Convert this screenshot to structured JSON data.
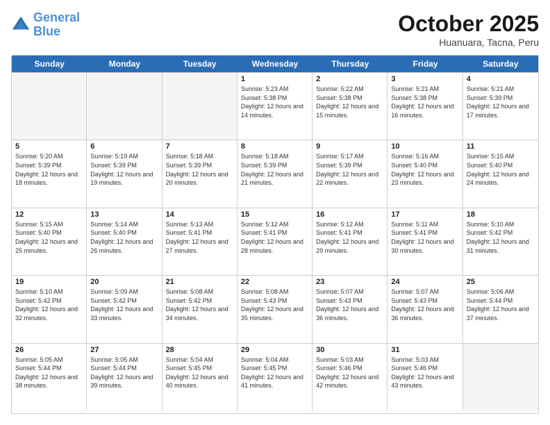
{
  "header": {
    "logo_line1": "General",
    "logo_line2": "Blue",
    "month": "October 2025",
    "location": "Huanuara, Tacna, Peru"
  },
  "weekdays": [
    "Sunday",
    "Monday",
    "Tuesday",
    "Wednesday",
    "Thursday",
    "Friday",
    "Saturday"
  ],
  "weeks": [
    [
      {
        "day": "",
        "info": "",
        "empty": true
      },
      {
        "day": "",
        "info": "",
        "empty": true
      },
      {
        "day": "",
        "info": "",
        "empty": true
      },
      {
        "day": "1",
        "info": "Sunrise: 5:23 AM\nSunset: 5:38 PM\nDaylight: 12 hours and 14 minutes.",
        "empty": false
      },
      {
        "day": "2",
        "info": "Sunrise: 5:22 AM\nSunset: 5:38 PM\nDaylight: 12 hours and 15 minutes.",
        "empty": false
      },
      {
        "day": "3",
        "info": "Sunrise: 5:21 AM\nSunset: 5:38 PM\nDaylight: 12 hours and 16 minutes.",
        "empty": false
      },
      {
        "day": "4",
        "info": "Sunrise: 5:21 AM\nSunset: 5:39 PM\nDaylight: 12 hours and 17 minutes.",
        "empty": false
      }
    ],
    [
      {
        "day": "5",
        "info": "Sunrise: 5:20 AM\nSunset: 5:39 PM\nDaylight: 12 hours and 18 minutes.",
        "empty": false
      },
      {
        "day": "6",
        "info": "Sunrise: 5:19 AM\nSunset: 5:39 PM\nDaylight: 12 hours and 19 minutes.",
        "empty": false
      },
      {
        "day": "7",
        "info": "Sunrise: 5:18 AM\nSunset: 5:39 PM\nDaylight: 12 hours and 20 minutes.",
        "empty": false
      },
      {
        "day": "8",
        "info": "Sunrise: 5:18 AM\nSunset: 5:39 PM\nDaylight: 12 hours and 21 minutes.",
        "empty": false
      },
      {
        "day": "9",
        "info": "Sunrise: 5:17 AM\nSunset: 5:39 PM\nDaylight: 12 hours and 22 minutes.",
        "empty": false
      },
      {
        "day": "10",
        "info": "Sunrise: 5:16 AM\nSunset: 5:40 PM\nDaylight: 12 hours and 23 minutes.",
        "empty": false
      },
      {
        "day": "11",
        "info": "Sunrise: 5:15 AM\nSunset: 5:40 PM\nDaylight: 12 hours and 24 minutes.",
        "empty": false
      }
    ],
    [
      {
        "day": "12",
        "info": "Sunrise: 5:15 AM\nSunset: 5:40 PM\nDaylight: 12 hours and 25 minutes.",
        "empty": false
      },
      {
        "day": "13",
        "info": "Sunrise: 5:14 AM\nSunset: 5:40 PM\nDaylight: 12 hours and 26 minutes.",
        "empty": false
      },
      {
        "day": "14",
        "info": "Sunrise: 5:13 AM\nSunset: 5:41 PM\nDaylight: 12 hours and 27 minutes.",
        "empty": false
      },
      {
        "day": "15",
        "info": "Sunrise: 5:12 AM\nSunset: 5:41 PM\nDaylight: 12 hours and 28 minutes.",
        "empty": false
      },
      {
        "day": "16",
        "info": "Sunrise: 5:12 AM\nSunset: 5:41 PM\nDaylight: 12 hours and 29 minutes.",
        "empty": false
      },
      {
        "day": "17",
        "info": "Sunrise: 5:11 AM\nSunset: 5:41 PM\nDaylight: 12 hours and 30 minutes.",
        "empty": false
      },
      {
        "day": "18",
        "info": "Sunrise: 5:10 AM\nSunset: 5:42 PM\nDaylight: 12 hours and 31 minutes.",
        "empty": false
      }
    ],
    [
      {
        "day": "19",
        "info": "Sunrise: 5:10 AM\nSunset: 5:42 PM\nDaylight: 12 hours and 32 minutes.",
        "empty": false
      },
      {
        "day": "20",
        "info": "Sunrise: 5:09 AM\nSunset: 5:42 PM\nDaylight: 12 hours and 33 minutes.",
        "empty": false
      },
      {
        "day": "21",
        "info": "Sunrise: 5:08 AM\nSunset: 5:42 PM\nDaylight: 12 hours and 34 minutes.",
        "empty": false
      },
      {
        "day": "22",
        "info": "Sunrise: 5:08 AM\nSunset: 5:43 PM\nDaylight: 12 hours and 35 minutes.",
        "empty": false
      },
      {
        "day": "23",
        "info": "Sunrise: 5:07 AM\nSunset: 5:43 PM\nDaylight: 12 hours and 36 minutes.",
        "empty": false
      },
      {
        "day": "24",
        "info": "Sunrise: 5:07 AM\nSunset: 5:43 PM\nDaylight: 12 hours and 36 minutes.",
        "empty": false
      },
      {
        "day": "25",
        "info": "Sunrise: 5:06 AM\nSunset: 5:44 PM\nDaylight: 12 hours and 37 minutes.",
        "empty": false
      }
    ],
    [
      {
        "day": "26",
        "info": "Sunrise: 5:05 AM\nSunset: 5:44 PM\nDaylight: 12 hours and 38 minutes.",
        "empty": false
      },
      {
        "day": "27",
        "info": "Sunrise: 5:05 AM\nSunset: 5:44 PM\nDaylight: 12 hours and 39 minutes.",
        "empty": false
      },
      {
        "day": "28",
        "info": "Sunrise: 5:04 AM\nSunset: 5:45 PM\nDaylight: 12 hours and 40 minutes.",
        "empty": false
      },
      {
        "day": "29",
        "info": "Sunrise: 5:04 AM\nSunset: 5:45 PM\nDaylight: 12 hours and 41 minutes.",
        "empty": false
      },
      {
        "day": "30",
        "info": "Sunrise: 5:03 AM\nSunset: 5:46 PM\nDaylight: 12 hours and 42 minutes.",
        "empty": false
      },
      {
        "day": "31",
        "info": "Sunrise: 5:03 AM\nSunset: 5:46 PM\nDaylight: 12 hours and 43 minutes.",
        "empty": false
      },
      {
        "day": "",
        "info": "",
        "empty": true
      }
    ]
  ]
}
